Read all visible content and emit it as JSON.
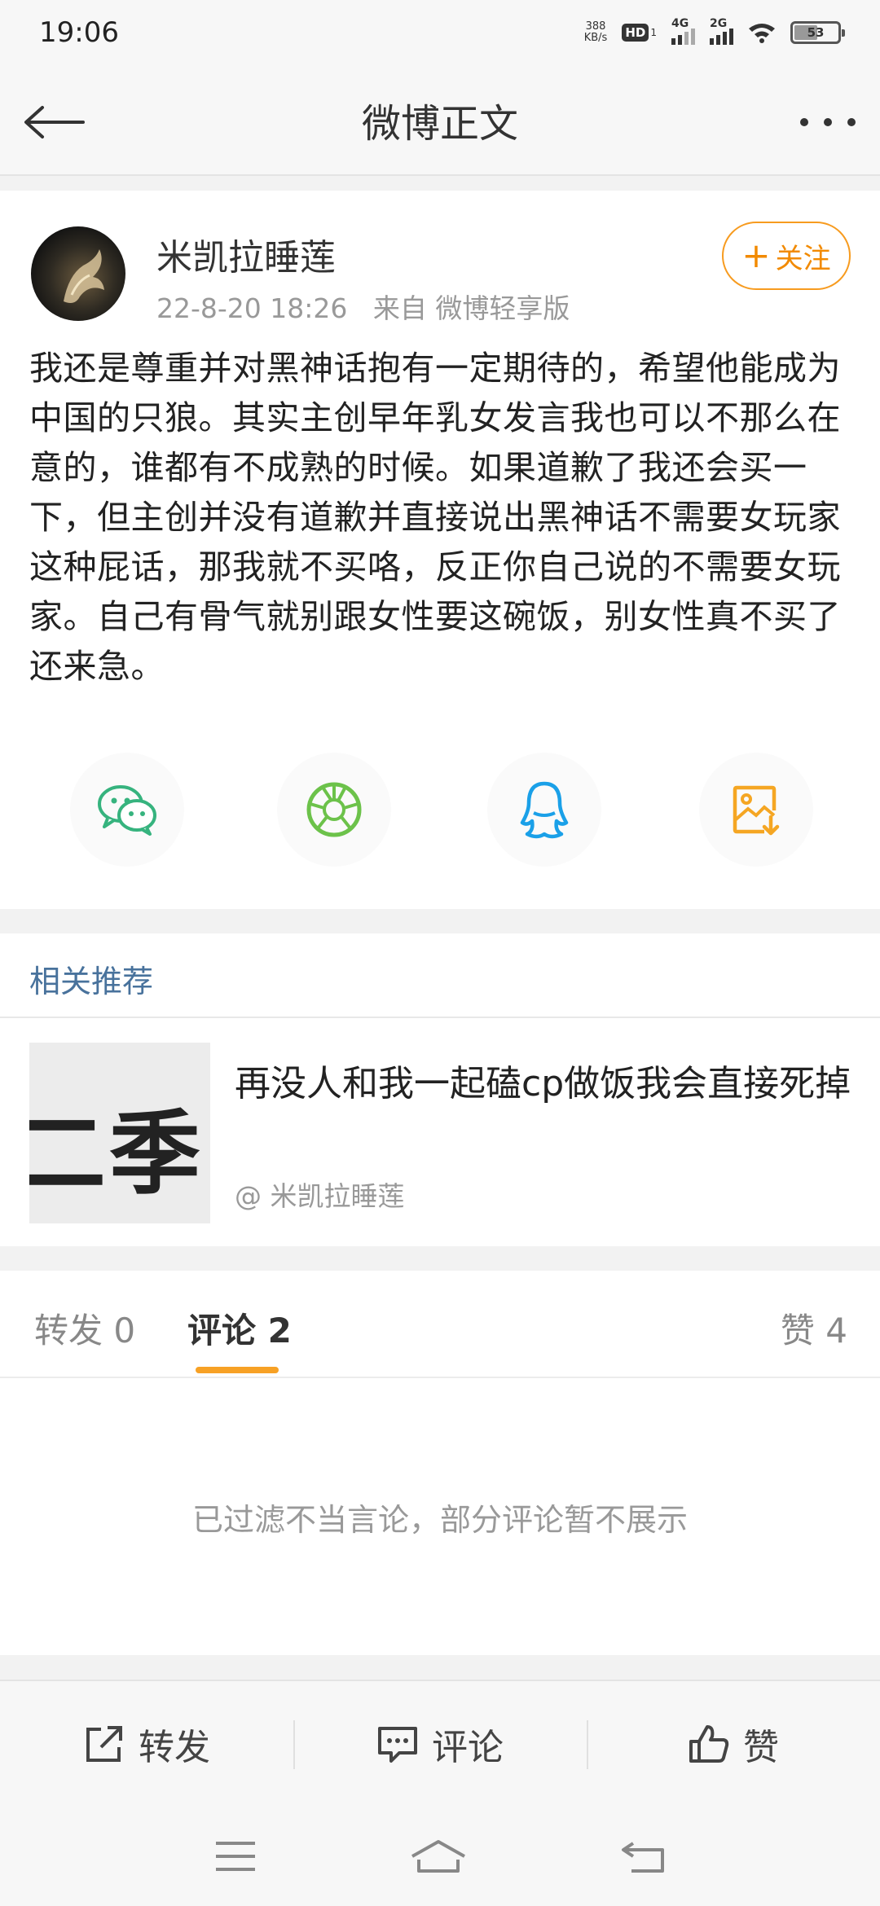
{
  "status_bar": {
    "time": "19:06",
    "net_speed_value": "388",
    "net_speed_unit": "KB/s",
    "hd_label": "HD",
    "hd_sub": "1",
    "signal_1_label": "4G",
    "signal_2_label": "2G",
    "battery": "53"
  },
  "header": {
    "title": "微博正文",
    "back_icon": "back-arrow-icon",
    "more_icon": "more-dots-icon"
  },
  "post": {
    "author": "米凯拉睡莲",
    "timestamp": "22-8-20 18:26",
    "source": "来自 微博轻享版",
    "follow_label": "关注",
    "follow_plus": "+",
    "text": "我还是尊重并对黑神话抱有一定期待的，希望他能成为中国的只狼。其实主创早年乳女发言我也可以不那么在意的，谁都有不成熟的时候。如果道歉了我还会买一下，但主创并没有道歉并直接说出黑神话不需要女玩家这种屁话，那我就不买咯，反正你自己说的不需要女玩家。自己有骨气就别跟女性要这碗饭，别女性真不买了还来急。",
    "share_icons": [
      "wechat-icon",
      "moments-icon",
      "qq-icon",
      "save-image-icon"
    ],
    "share_colors": [
      "#36b37e",
      "#6cc24a",
      "#1aa0e8",
      "#f5a623"
    ]
  },
  "related": {
    "title": "相关推荐",
    "thumb_text": "二季 烈",
    "headline": "再没人和我一起磕cp做饭我会直接死掉",
    "source": "@ 米凯拉睡莲"
  },
  "tabs": {
    "repost": "转发 0",
    "comments": "评论 2",
    "likes": "赞 4",
    "active_color": "#f7a125"
  },
  "comments": {
    "empty_notice": "已过滤不当言论，部分评论暂不展示"
  },
  "action_bar": {
    "repost_label": "转发",
    "comment_label": "评论",
    "like_label": "赞"
  },
  "nav_bar": {
    "icons": [
      "menu-icon",
      "home-icon",
      "back-icon"
    ]
  }
}
